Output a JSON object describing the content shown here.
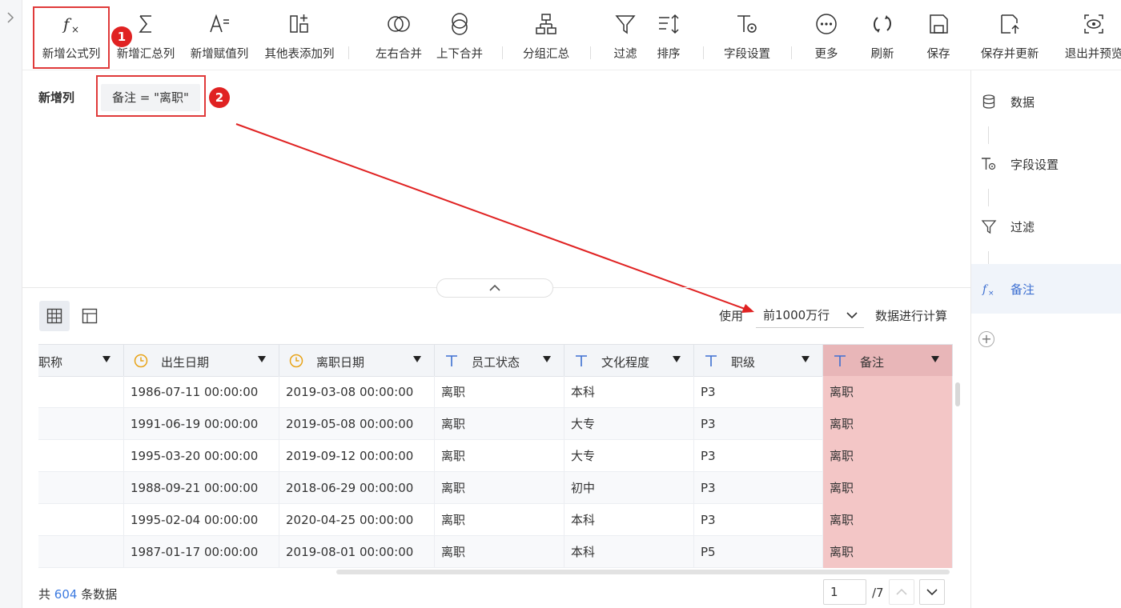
{
  "toolbar": {
    "add_formula_column": "新增公式列",
    "add_summary_column": "新增汇总列",
    "add_assign_column": "新增赋值列",
    "add_other_table_column": "其他表添加列",
    "merge_left_right": "左右合并",
    "merge_top_bottom": "上下合并",
    "group_summary": "分组汇总",
    "filter": "过滤",
    "sort": "排序",
    "field_settings": "字段设置",
    "more": "更多",
    "refresh": "刷新",
    "save": "保存",
    "save_and_update": "保存并更新",
    "exit_preview": "退出并预览"
  },
  "annotations": {
    "badge_1": "1",
    "badge_2": "2",
    "accent": "#e02222"
  },
  "formula_panel": {
    "title": "新增列",
    "formula_chip": "备注 = \"离职\""
  },
  "data_controls": {
    "use_label": "使用",
    "rows_option": "前1000万行",
    "calc_label": "数据进行计算"
  },
  "grid": {
    "columns": [
      {
        "label": "职称",
        "type": "text"
      },
      {
        "label": "出生日期",
        "type": "date"
      },
      {
        "label": "离职日期",
        "type": "date"
      },
      {
        "label": "员工状态",
        "type": "text"
      },
      {
        "label": "文化程度",
        "type": "text"
      },
      {
        "label": "职级",
        "type": "text"
      },
      {
        "label": "备注",
        "type": "text"
      }
    ],
    "rows": [
      [
        "",
        "1986-07-11 00:00:00",
        "2019-03-08 00:00:00",
        "离职",
        "本科",
        "P3",
        "离职"
      ],
      [
        "",
        "1991-06-19 00:00:00",
        "2019-05-08 00:00:00",
        "离职",
        "大专",
        "P3",
        "离职"
      ],
      [
        "",
        "1995-03-20 00:00:00",
        "2019-09-12 00:00:00",
        "离职",
        "大专",
        "P3",
        "离职"
      ],
      [
        "",
        "1988-09-21 00:00:00",
        "2018-06-29 00:00:00",
        "离职",
        "初中",
        "P3",
        "离职"
      ],
      [
        "",
        "1995-02-04 00:00:00",
        "2020-04-25 00:00:00",
        "离职",
        "本科",
        "P3",
        "离职"
      ],
      [
        "",
        "1987-01-17 00:00:00",
        "2019-08-01 00:00:00",
        "离职",
        "本科",
        "P5",
        "离职"
      ]
    ],
    "highlight_color": "#f3c6c6"
  },
  "footer": {
    "count_prefix": "共",
    "count": "604",
    "count_suffix": "条数据",
    "page_current": "1",
    "page_total": "/7"
  },
  "steps_panel": {
    "steps": [
      {
        "label": "数据",
        "icon": "database-icon"
      },
      {
        "label": "字段设置",
        "icon": "field-settings-icon"
      },
      {
        "label": "过滤",
        "icon": "filter-icon"
      },
      {
        "label": "备注",
        "icon": "formula-icon"
      }
    ],
    "active_color": "#3d6fd1"
  }
}
